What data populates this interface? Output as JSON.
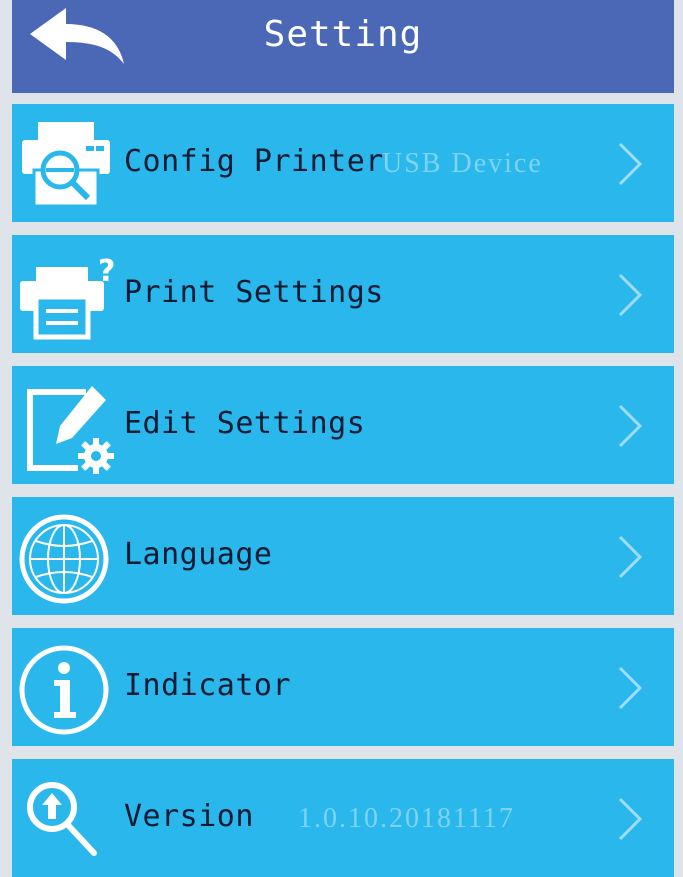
{
  "header": {
    "title": "Setting",
    "back_icon": "back-arrow-icon"
  },
  "colors": {
    "header_bg": "#4a68b5",
    "row_bg": "#2ab7ec",
    "label": "#0b1b33",
    "value": "#7fd3f3"
  },
  "items": [
    {
      "label": "Config Printer",
      "value": "USB Device",
      "icon": "printer-config-icon"
    },
    {
      "label": "Print Settings",
      "value": "",
      "icon": "printer-question-icon"
    },
    {
      "label": "Edit Settings",
      "value": "",
      "icon": "edit-gear-icon"
    },
    {
      "label": "Language",
      "value": "",
      "icon": "globe-icon"
    },
    {
      "label": "Indicator",
      "value": "",
      "icon": "info-icon"
    },
    {
      "label": "Version",
      "value": "1.0.10.20181117",
      "icon": "search-upload-icon"
    }
  ]
}
